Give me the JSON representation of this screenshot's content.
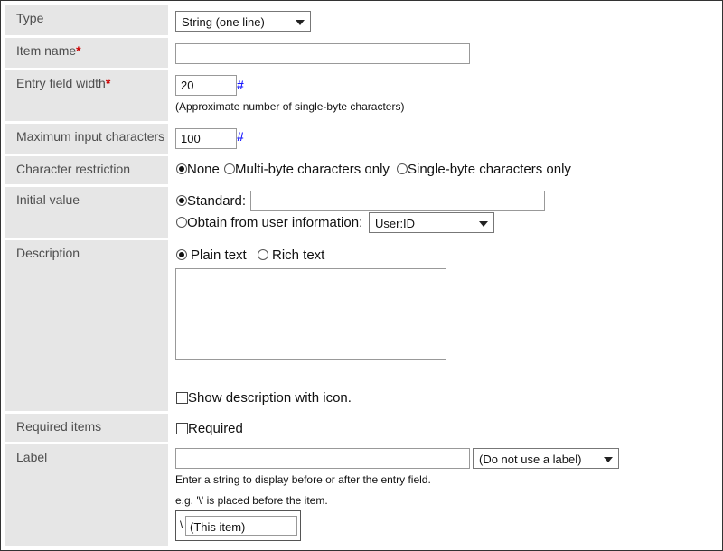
{
  "type_row": {
    "label": "Type",
    "selected": "String (one line)"
  },
  "item_name_row": {
    "label": "Item name",
    "required_mark": "*",
    "value": ""
  },
  "entry_width_row": {
    "label": "Entry field width",
    "required_mark": "*",
    "value": "20",
    "hash": "#",
    "note": "(Approximate number of single-byte characters)"
  },
  "max_chars_row": {
    "label": "Maximum input characters",
    "value": "100",
    "hash": "#"
  },
  "char_restriction_row": {
    "label": "Character restriction",
    "options": [
      "None",
      "Multi-byte characters only",
      "Single-byte characters only"
    ],
    "selected_index": 0
  },
  "initial_value_row": {
    "label": "Initial value",
    "standard_label": "Standard:",
    "standard_value": "",
    "user_info_label": "Obtain from user information:",
    "user_info_selected": "User:ID"
  },
  "description_row": {
    "label": "Description",
    "plain_text": "Plain text",
    "rich_text": "Rich text",
    "textarea_value": "",
    "show_icon_label": "Show description with icon."
  },
  "required_row": {
    "label": "Required items",
    "checkbox_label": "Required"
  },
  "label_row": {
    "label": "Label",
    "value": "",
    "select_selected": "(Do not use a label)",
    "help": "Enter a string to display before or after the entry field.",
    "example": "e.g.  '\\' is placed before the item.",
    "example_prefix": "\\",
    "example_item": "(This item)"
  }
}
